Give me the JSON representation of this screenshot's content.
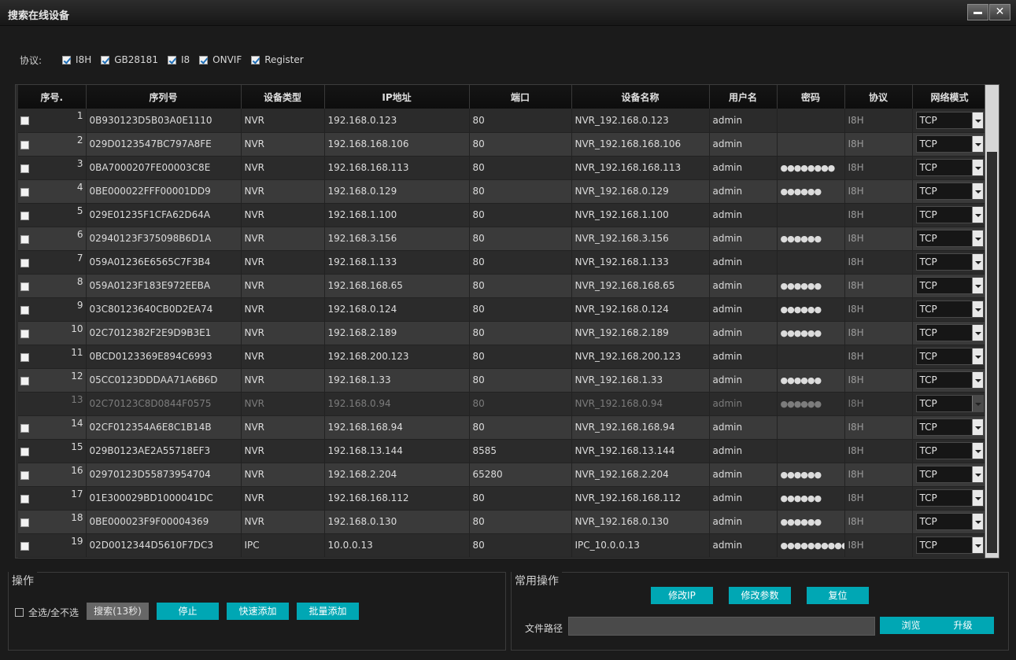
{
  "window": {
    "title": "搜索在线设备",
    "min_label": "",
    "close_label": "✕"
  },
  "protocols": {
    "label": "协议:",
    "items": [
      {
        "label": "I8H",
        "checked": true
      },
      {
        "label": "GB28181",
        "checked": true
      },
      {
        "label": "I8",
        "checked": true
      },
      {
        "label": "ONVIF",
        "checked": true
      },
      {
        "label": "Register",
        "checked": true
      }
    ]
  },
  "table": {
    "headers": [
      "序号.",
      "序列号",
      "设备类型",
      "IP地址",
      "端口",
      "设备名称",
      "用户名",
      "密码",
      "协议",
      "网络模式"
    ],
    "rows": [
      {
        "no": "1",
        "serial": "0B930123D5B03A0E1110",
        "type": "NVR",
        "ip": "192.168.0.123",
        "port": "80",
        "name": "NVR_192.168.0.123",
        "user": "admin",
        "password": "",
        "protocol": "I8H",
        "mode": "TCP",
        "checkbox": true,
        "disabled": false
      },
      {
        "no": "2",
        "serial": "029D0123547BC797A8FE",
        "type": "NVR",
        "ip": "192.168.168.106",
        "port": "80",
        "name": "NVR_192.168.168.106",
        "user": "admin",
        "password": "",
        "protocol": "I8H",
        "mode": "TCP",
        "checkbox": true,
        "disabled": false
      },
      {
        "no": "3",
        "serial": "0BA7000207FE00003C8E",
        "type": "NVR",
        "ip": "192.168.168.113",
        "port": "80",
        "name": "NVR_192.168.168.113",
        "user": "admin",
        "password": "●●●●●●●●",
        "protocol": "I8H",
        "mode": "TCP",
        "checkbox": true,
        "disabled": false
      },
      {
        "no": "4",
        "serial": "0BE000022FFF00001DD9",
        "type": "NVR",
        "ip": "192.168.0.129",
        "port": "80",
        "name": "NVR_192.168.0.129",
        "user": "admin",
        "password": "●●●●●●",
        "protocol": "I8H",
        "mode": "TCP",
        "checkbox": true,
        "disabled": false
      },
      {
        "no": "5",
        "serial": "029E01235F1CFA62D64A",
        "type": "NVR",
        "ip": "192.168.1.100",
        "port": "80",
        "name": "NVR_192.168.1.100",
        "user": "admin",
        "password": "",
        "protocol": "I8H",
        "mode": "TCP",
        "checkbox": true,
        "disabled": false
      },
      {
        "no": "6",
        "serial": "02940123F375098B6D1A",
        "type": "NVR",
        "ip": "192.168.3.156",
        "port": "80",
        "name": "NVR_192.168.3.156",
        "user": "admin",
        "password": "●●●●●●",
        "protocol": "I8H",
        "mode": "TCP",
        "checkbox": true,
        "disabled": false
      },
      {
        "no": "7",
        "serial": "059A01236E6565C7F3B4",
        "type": "NVR",
        "ip": "192.168.1.133",
        "port": "80",
        "name": "NVR_192.168.1.133",
        "user": "admin",
        "password": "",
        "protocol": "I8H",
        "mode": "TCP",
        "checkbox": true,
        "disabled": false
      },
      {
        "no": "8",
        "serial": "059A0123F183E972EEBA",
        "type": "NVR",
        "ip": "192.168.168.65",
        "port": "80",
        "name": "NVR_192.168.168.65",
        "user": "admin",
        "password": "●●●●●●",
        "protocol": "I8H",
        "mode": "TCP",
        "checkbox": true,
        "disabled": false
      },
      {
        "no": "9",
        "serial": "03C80123640CB0D2EA74",
        "type": "NVR",
        "ip": "192.168.0.124",
        "port": "80",
        "name": "NVR_192.168.0.124",
        "user": "admin",
        "password": "●●●●●●",
        "protocol": "I8H",
        "mode": "TCP",
        "checkbox": true,
        "disabled": false
      },
      {
        "no": "10",
        "serial": "02C7012382F2E9D9B3E1",
        "type": "NVR",
        "ip": "192.168.2.189",
        "port": "80",
        "name": "NVR_192.168.2.189",
        "user": "admin",
        "password": "●●●●●●",
        "protocol": "I8H",
        "mode": "TCP",
        "checkbox": true,
        "disabled": false
      },
      {
        "no": "11",
        "serial": "0BCD0123369E894C6993",
        "type": "NVR",
        "ip": "192.168.200.123",
        "port": "80",
        "name": "NVR_192.168.200.123",
        "user": "admin",
        "password": "",
        "protocol": "I8H",
        "mode": "TCP",
        "checkbox": true,
        "disabled": false
      },
      {
        "no": "12",
        "serial": "05CC0123DDDAA71A6B6D",
        "type": "NVR",
        "ip": "192.168.1.33",
        "port": "80",
        "name": "NVR_192.168.1.33",
        "user": "admin",
        "password": "●●●●●●",
        "protocol": "I8H",
        "mode": "TCP",
        "checkbox": true,
        "disabled": false
      },
      {
        "no": "13",
        "serial": "02C70123C8D0844F0575",
        "type": "NVR",
        "ip": "192.168.0.94",
        "port": "80",
        "name": "NVR_192.168.0.94",
        "user": "admin",
        "password": "●●●●●●",
        "protocol": "I8H",
        "mode": "TCP",
        "checkbox": false,
        "disabled": true
      },
      {
        "no": "14",
        "serial": "02CF012354A6E8C1B14B",
        "type": "NVR",
        "ip": "192.168.168.94",
        "port": "80",
        "name": "NVR_192.168.168.94",
        "user": "admin",
        "password": "",
        "protocol": "I8H",
        "mode": "TCP",
        "checkbox": true,
        "disabled": false
      },
      {
        "no": "15",
        "serial": "029B0123AE2A55718EF3",
        "type": "NVR",
        "ip": "192.168.13.144",
        "port": "8585",
        "name": "NVR_192.168.13.144",
        "user": "admin",
        "password": "",
        "protocol": "I8H",
        "mode": "TCP",
        "checkbox": true,
        "disabled": false
      },
      {
        "no": "16",
        "serial": "02970123D55873954704",
        "type": "NVR",
        "ip": "192.168.2.204",
        "port": "65280",
        "name": "NVR_192.168.2.204",
        "user": "admin",
        "password": "●●●●●●",
        "protocol": "I8H",
        "mode": "TCP",
        "checkbox": true,
        "disabled": false
      },
      {
        "no": "17",
        "serial": "01E300029BD1000041DC",
        "type": "NVR",
        "ip": "192.168.168.112",
        "port": "80",
        "name": "NVR_192.168.168.112",
        "user": "admin",
        "password": "●●●●●●",
        "protocol": "I8H",
        "mode": "TCP",
        "checkbox": true,
        "disabled": false
      },
      {
        "no": "18",
        "serial": "0BE000023F9F00004369",
        "type": "NVR",
        "ip": "192.168.0.130",
        "port": "80",
        "name": "NVR_192.168.0.130",
        "user": "admin",
        "password": "●●●●●●",
        "protocol": "I8H",
        "mode": "TCP",
        "checkbox": true,
        "disabled": false
      },
      {
        "no": "19",
        "serial": "02D0012344D5610F7DC3",
        "type": "IPC",
        "ip": "10.0.0.13",
        "port": "80",
        "name": "IPC_10.0.0.13",
        "user": "admin",
        "password": "●●●●●●●●●●",
        "protocol": "I8H",
        "mode": "TCP",
        "checkbox": true,
        "disabled": false
      }
    ]
  },
  "operation": {
    "legend": "操作",
    "select_all_label": "全选/全不选",
    "search_label": "搜索(13秒)",
    "stop_label": "停止",
    "quick_add_label": "快速添加",
    "batch_add_label": "批量添加"
  },
  "common": {
    "legend": "常用操作",
    "modify_ip_label": "修改IP",
    "modify_params_label": "修改参数",
    "reset_label": "复位",
    "file_path_label": "文件路径",
    "file_path_value": "",
    "browse_label": "浏览",
    "upgrade_label": "升级"
  },
  "colors": {
    "accent": "#00a7b4",
    "background": "#1b1b1b",
    "row_even": "#3a3a3a",
    "row_odd": "#2b2b2b"
  }
}
